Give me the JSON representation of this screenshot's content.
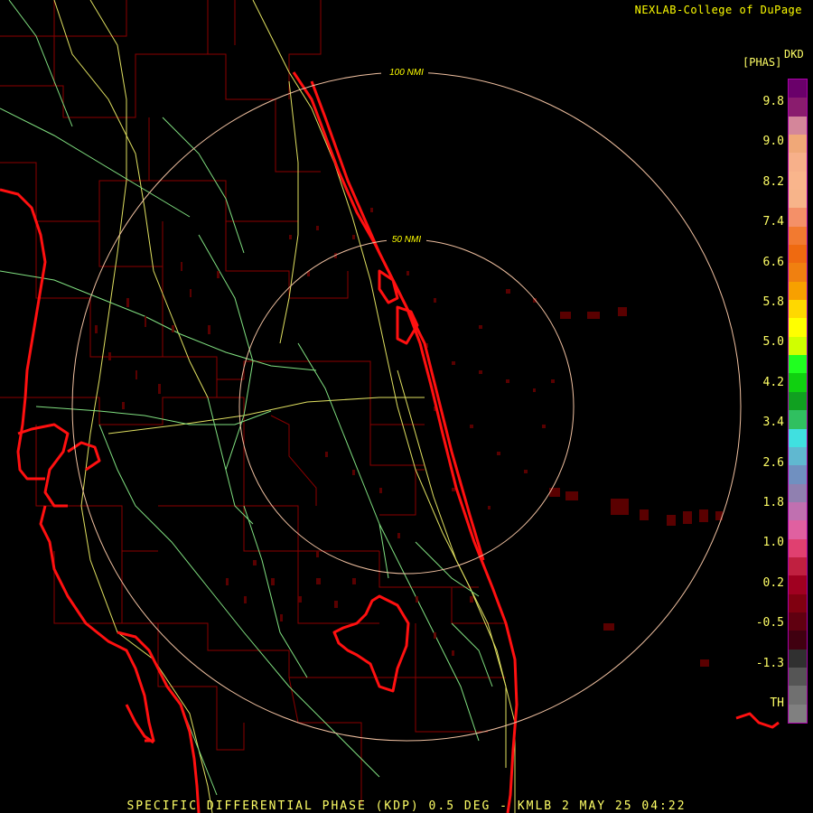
{
  "credit": "NEXLAB-College of DuPage",
  "product": {
    "code": "DKD",
    "unit": "[PHAS]"
  },
  "footer": "SPECIFIC DIFFERENTIAL PHASE (KDP) 0.5 DEG - KMLB 2 MAY 25 04:22",
  "range_rings": [
    {
      "label": "100 NMI",
      "radius_nmi": 100
    },
    {
      "label": "50 NMI",
      "radius_nmi": 50
    }
  ],
  "legend": {
    "labels": [
      "9.8",
      "9.0",
      "8.2",
      "7.4",
      "6.6",
      "5.8",
      "5.0",
      "4.2",
      "3.4",
      "2.6",
      "1.8",
      "1.0",
      "0.2",
      "-0.5",
      "-1.3",
      "TH"
    ],
    "colors": [
      "#6a006a",
      "#8a1c6e",
      "#d4869a",
      "#f0a878",
      "#f7b08a",
      "#f9b58c",
      "#f7b48a",
      "#f49068",
      "#f27a30",
      "#ef6a10",
      "#f08010",
      "#f7a000",
      "#ffd800",
      "#ffff00",
      "#d0ff00",
      "#20ff20",
      "#10d010",
      "#10a020",
      "#30c060",
      "#40e0e0",
      "#60b8d0",
      "#7090c0",
      "#9080b0",
      "#c070b0",
      "#e060a0",
      "#e04070",
      "#c02040",
      "#a00020",
      "#800010",
      "#600010",
      "#400010",
      "#303030",
      "#555555",
      "#707070",
      "#808080"
    ]
  }
}
